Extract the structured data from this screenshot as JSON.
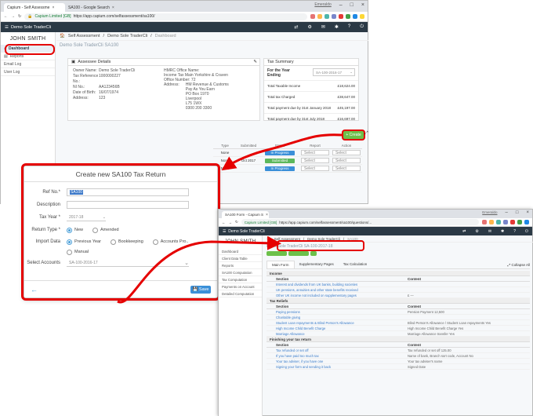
{
  "win1": {
    "tabs": [
      {
        "label": "Capium - Self Assessme"
      },
      {
        "label": "SA100 - Google Search"
      }
    ],
    "profile": "Emeraldo",
    "url_site": "Capium Limited [GB]",
    "url": "https://app.capium.com/selfassessment/sa100/",
    "client": "Demo Sole TraderCli",
    "user": "JOHN SMITH",
    "sidebar": [
      "Dashboard",
      "Reports",
      "Email Log",
      "User Log"
    ],
    "breadcrumb": [
      "Self Assessment",
      "Demo Sole TraderCli",
      "Dashboard"
    ],
    "page_title": "Demo Sole TraderCli SA100",
    "assessee": {
      "title": "Assessee Details",
      "rows": [
        {
          "k": "Owner Name:",
          "v": "Demo Sole TraderCli"
        },
        {
          "k": "Tax Reference No.:",
          "v": "1000000227"
        },
        {
          "k": "NI No.:",
          "v": "AA123456B"
        },
        {
          "k": "Date of Birth:",
          "v": "16/07/1974"
        },
        {
          "k": "Address:",
          "v": "123"
        }
      ],
      "hmrc": [
        "HMRC Office Name:",
        "Income Tax Main Yorkshire & Craven",
        "Office Number:"
      ],
      "hmrc_num": "72",
      "hmrc_addr_label": "Address:",
      "hmrc_addr": [
        "HM Revenue & Customs",
        "Pay As You Earn",
        "PO Box 1970",
        "Liverpool",
        "L75 1WX",
        "0300 200 3300"
      ]
    },
    "summary": {
      "title": "Tax Summary",
      "year_label": "For the Year Ending",
      "year_value": "SA-100-2016-17",
      "rows": [
        {
          "k": "Total Taxable Income",
          "v": "£18,624.00"
        },
        {
          "k": "Total tax Charged",
          "v": "£38,647.00"
        },
        {
          "k": "Total payment due by 31st January 2018",
          "v": "£45,197.00"
        },
        {
          "k": "Total payment due by 31st July 2018",
          "v": "£16,697.00"
        }
      ]
    },
    "create_label": "+ Create",
    "table_cols": [
      "Type",
      "Submitted",
      "Status",
      "Report",
      "Action"
    ],
    "table_rows": [
      {
        "type": "None",
        "submitted": "",
        "status": "In Progress",
        "report": "Select",
        "action": "Select"
      },
      {
        "type": "None",
        "submitted": "Oct 2017",
        "status": "Submitted",
        "report": "Select",
        "action": "Select"
      },
      {
        "type": "None",
        "submitted": "",
        "status": "In Progress",
        "report": "Select",
        "action": "Select"
      }
    ]
  },
  "modal": {
    "title": "Create new SA100 Tax Return",
    "ref_label": "Ref No.*",
    "ref_value": "SA100",
    "desc_label": "Description",
    "year_label": "Tax Year *",
    "year_value": "2017-18",
    "return_label": "Return Type *",
    "return_options": [
      {
        "label": "New",
        "on": true
      },
      {
        "label": "Amended",
        "on": false
      }
    ],
    "import_label": "Import Data",
    "import_options": [
      {
        "label": "Previous Year",
        "on": true
      },
      {
        "label": "Bookkeeping",
        "on": false
      },
      {
        "label": "Accounts Pro..",
        "on": false
      },
      {
        "label": "Manual",
        "on": false
      }
    ],
    "accounts_label": "Select Accounts",
    "accounts_value": "SA-100-2016-17",
    "back": "←",
    "save": "Save"
  },
  "win2": {
    "tab": "SA100 Form - Capium S",
    "profile": "Emeraldo",
    "url_site": "Capium Limited [GB]",
    "url": "https://app.capium.com/selfassessment/sa100/questions/...",
    "client": "Demo Sole TraderCli",
    "user": "JOHN SMITH",
    "sidebar": [
      "Dashboard",
      "Client Data Table",
      "Reports",
      "SA100 Computation",
      "Tax Computation",
      "Payments on Account",
      "Detailed Computation"
    ],
    "breadcrumb": [
      "Self Assessment",
      "Demo Sole TraderCli",
      "SA100"
    ],
    "page_title": "Demo Sole TraderCli SA-100-2017-18",
    "subtabs": [
      "Main Form",
      "Supplementary Pages",
      "Tax Calculation"
    ],
    "collapse": "Collapse All",
    "sections": [
      {
        "title": "Income",
        "cols": [
          "Section",
          "Content"
        ],
        "rows": [
          {
            "l": "Interest and dividends from UK banks, building societies",
            "r": ""
          },
          {
            "l": "UK pensions, annuities and other state benefits received",
            "r": ""
          },
          {
            "l": "Other UK income not included on supplementary pages",
            "r": "£ —"
          }
        ]
      },
      {
        "title": "Tax Reliefs",
        "cols": [
          "Section",
          "Content"
        ],
        "rows": [
          {
            "l": "Paying pensions",
            "r": "Pension Payment 12,500"
          },
          {
            "l": "Charitable giving",
            "r": ""
          },
          {
            "l": "Student Loan repayments & Blind Person's Allowance",
            "r": "Blind Person's Allowance / Student Loan repayments Yes"
          },
          {
            "l": "High Income Child Benefit Charge",
            "r": "High Income Child Benefit Charge Yes"
          },
          {
            "l": "Marriage Allowance",
            "r": "Marriage Allowance transfer Yes"
          }
        ]
      },
      {
        "title": "Finishing your tax return",
        "cols": [
          "Section",
          "Content"
        ],
        "rows": [
          {
            "l": "Tax refunded or set off",
            "r": "Tax refunded or set off 125.00"
          },
          {
            "l": "If you have paid too much tax",
            "r": "Name of bank, Branch sort code, Account No"
          },
          {
            "l": "Your tax adviser, if you have one",
            "r": "Your tax adviser's name"
          },
          {
            "l": "Signing your form and sending it back",
            "r": "Signed Date"
          }
        ]
      }
    ]
  }
}
